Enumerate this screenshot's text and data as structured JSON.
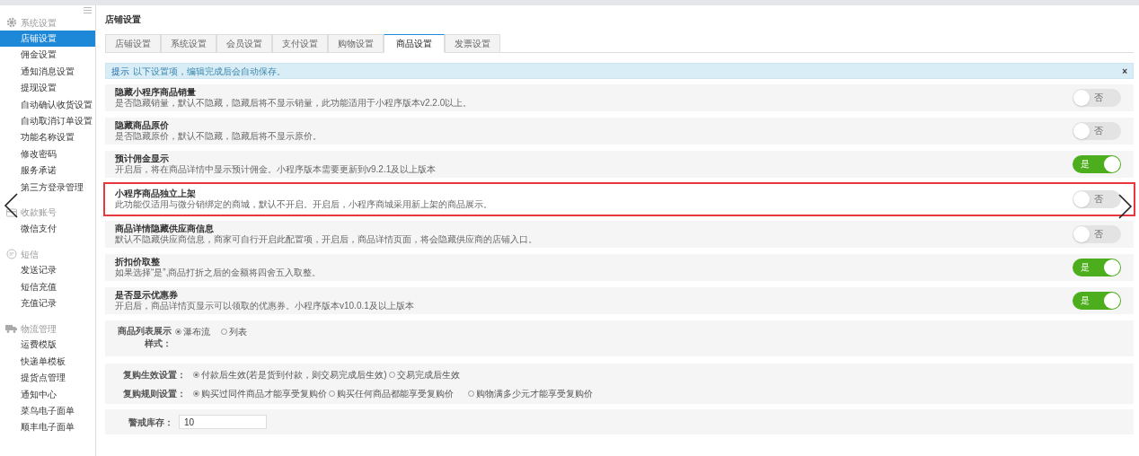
{
  "sidebar": {
    "groups": [
      {
        "title": "系统设置",
        "items": [
          {
            "label": "店铺设置",
            "selected": true
          },
          {
            "label": "佣金设置",
            "selected": false
          },
          {
            "label": "通知消息设置",
            "selected": false
          },
          {
            "label": "提现设置",
            "selected": false
          },
          {
            "label": "自动确认收货设置",
            "selected": false
          },
          {
            "label": "自动取消订单设置",
            "selected": false
          },
          {
            "label": "功能名称设置",
            "selected": false
          },
          {
            "label": "修改密码",
            "selected": false
          },
          {
            "label": "服务承诺",
            "selected": false
          },
          {
            "label": "第三方登录管理",
            "selected": false
          }
        ]
      },
      {
        "title": "收款账号",
        "items": [
          {
            "label": "微信支付",
            "selected": false
          }
        ]
      },
      {
        "title": "短信",
        "items": [
          {
            "label": "发送记录",
            "selected": false
          },
          {
            "label": "短信充值",
            "selected": false
          },
          {
            "label": "充值记录",
            "selected": false
          }
        ]
      },
      {
        "title": "物流管理",
        "items": [
          {
            "label": "运费模版",
            "selected": false
          },
          {
            "label": "快递单模板",
            "selected": false
          },
          {
            "label": "提货点管理",
            "selected": false
          },
          {
            "label": "通知中心",
            "selected": false
          },
          {
            "label": "菜鸟电子面单",
            "selected": false
          },
          {
            "label": "顺丰电子面单",
            "selected": false
          }
        ]
      }
    ]
  },
  "page_title": "店铺设置",
  "tabs": [
    {
      "label": "店铺设置",
      "selected": false
    },
    {
      "label": "系统设置",
      "selected": false
    },
    {
      "label": "会员设置",
      "selected": false
    },
    {
      "label": "支付设置",
      "selected": false
    },
    {
      "label": "购物设置",
      "selected": false
    },
    {
      "label": "商品设置",
      "selected": true
    },
    {
      "label": "发票设置",
      "selected": false
    }
  ],
  "notice": {
    "label": "提示",
    "text": "以下设置项，编辑完成后会自动保存。",
    "close": "×"
  },
  "settings": [
    {
      "title": "隐藏小程序商品销量",
      "description": "是否隐藏销量，默认不隐藏，隐藏后将不显示销量，此功能适用于小程序版本v2.2.0以上。",
      "on": false,
      "switch_label": "否",
      "highlighted": false
    },
    {
      "title": "隐藏商品原价",
      "description": "是否隐藏原价，默认不隐藏，隐藏后将不显示原价。",
      "on": false,
      "switch_label": "否",
      "highlighted": false
    },
    {
      "title": "预计佣金显示",
      "description": "开启后，将在商品详情中显示预计佣金。小程序版本需要更新到v9.2.1及以上版本",
      "on": true,
      "switch_label": "是",
      "highlighted": false
    },
    {
      "title": "小程序商品独立上架",
      "description": "此功能仅适用与微分销绑定的商城，默认不开启。开启后，小程序商城采用新上架的商品展示。",
      "on": false,
      "switch_label": "否",
      "highlighted": true
    },
    {
      "title": "商品详情隐藏供应商信息",
      "description": "默认不隐藏供应商信息，商家可自行开启此配置项，开启后，商品详情页面，将会隐藏供应商的店铺入口。",
      "on": false,
      "switch_label": "否",
      "highlighted": false
    },
    {
      "title": "折扣价取整",
      "description": "如果选择“是”,商品打折之后的金额将四舍五入取整。",
      "on": true,
      "switch_label": "是",
      "highlighted": false
    },
    {
      "title": "是否显示优惠券",
      "description": "开启后，商品详情页显示可以领取的优惠券。小程序版本v10.0.1及以上版本",
      "on": true,
      "switch_label": "是",
      "highlighted": false
    }
  ],
  "list_style": {
    "label": "商品列表展示样式：",
    "options": [
      {
        "label": "瀑布流",
        "selected": true
      },
      {
        "label": "列表",
        "selected": false
      }
    ]
  },
  "repurchase": [
    {
      "label": "复购生效设置：",
      "options": [
        {
          "label": "付款后生效(若是货到付款，则交易完成后生效)",
          "selected": true
        },
        {
          "label": "交易完成后生效",
          "selected": false
        }
      ]
    },
    {
      "label": "复购规则设置：",
      "options": [
        {
          "label": "购买过同件商品才能享受复购价",
          "selected": true
        },
        {
          "label": "购买任何商品都能享受复购价",
          "selected": false
        },
        {
          "label": "购物满多少元才能享受复购价",
          "selected": false
        }
      ]
    }
  ],
  "stock_alert": {
    "label": "警戒库存：",
    "value": "10"
  }
}
